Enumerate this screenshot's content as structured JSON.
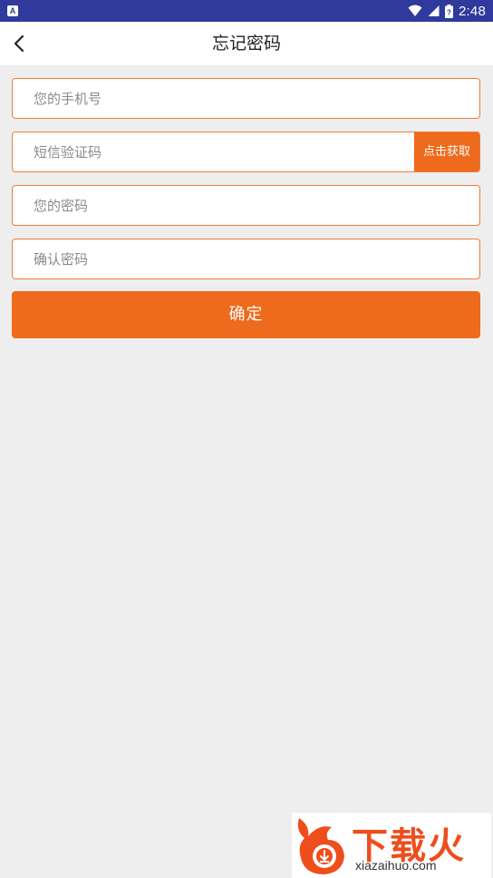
{
  "status_bar": {
    "app_indicator": "A",
    "time": "2:48",
    "icons": [
      "wifi-icon",
      "signal-icon",
      "battery-icon"
    ]
  },
  "nav": {
    "back_icon": "chevron-left-icon",
    "title": "忘记密码"
  },
  "form": {
    "phone_placeholder": "您的手机号",
    "code_placeholder": "短信验证码",
    "get_code_label": "点击获取",
    "password_placeholder": "您的密码",
    "confirm_password_placeholder": "确认密码",
    "submit_label": "确定"
  },
  "watermark": {
    "brand_cn": "下载火",
    "brand_en": "xiazaihuo.com"
  },
  "colors": {
    "status_bar": "#2f3a9c",
    "accent": "#ee6a1c",
    "field_border": "#ee7b3a",
    "background": "#eeeeee"
  }
}
